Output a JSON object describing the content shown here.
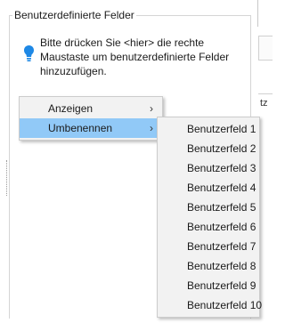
{
  "groupbox": {
    "title": "Benutzerdefinierte Felder",
    "hint_icon": "lightbulb-icon",
    "hint_text": "Bitte drücken Sie <hier> die rechte Maustaste um benutzerdefinierte Felder hinzuzufügen."
  },
  "context_menu": {
    "items": [
      {
        "label": "Anzeigen",
        "icon": "chevron-right-icon"
      },
      {
        "label": "Umbenennen",
        "icon": "chevron-right-icon",
        "active": true
      }
    ]
  },
  "submenu": {
    "items": [
      "Benutzerfeld 1",
      "Benutzerfeld 2",
      "Benutzerfeld 3",
      "Benutzerfeld 4",
      "Benutzerfeld 5",
      "Benutzerfeld 6",
      "Benutzerfeld 7",
      "Benutzerfeld 8",
      "Benutzerfeld 9",
      "Benutzerfeld 10"
    ]
  },
  "right_fragment": "tz",
  "colors": {
    "menu_background": "#f2f2f2",
    "menu_highlight": "#91c9f7",
    "border": "#cccccc",
    "hint_icon": "#1e88e5"
  }
}
